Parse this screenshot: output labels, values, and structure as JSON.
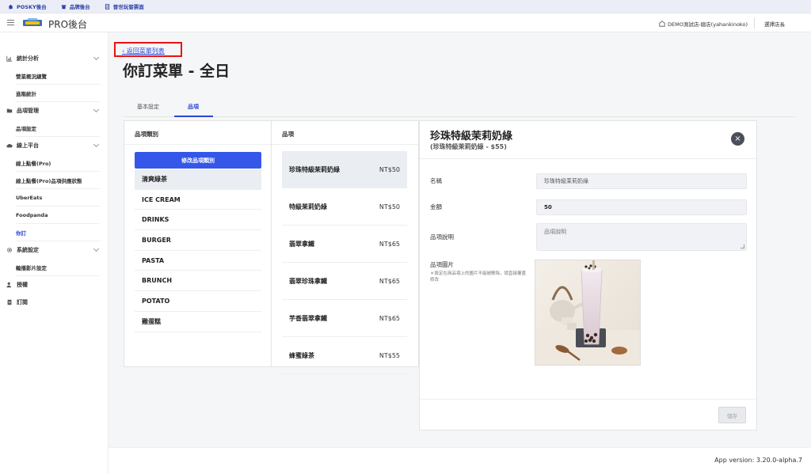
{
  "topbar": {
    "links": [
      {
        "label": "POSKY後台",
        "icon": "home-icon"
      },
      {
        "label": "品牌後台",
        "icon": "store-icon"
      },
      {
        "label": "晉世玩發票面",
        "icon": "receipt-icon"
      }
    ]
  },
  "header": {
    "brand": "PRO後台",
    "store": "DEMO測試店-總店(yahankinoko)",
    "switch_label": "選擇店長"
  },
  "sidebar": {
    "groups": [
      {
        "label": "統計分析",
        "icon": "chart-icon",
        "items": [
          "營業概況總覽",
          "進階統計"
        ]
      },
      {
        "label": "品項管理",
        "icon": "folder-icon",
        "items": [
          "品項設定"
        ]
      },
      {
        "label": "線上平台",
        "icon": "cloud-icon",
        "items": [
          "線上點餐(Pro)",
          "線上點餐(Pro)品項供應狀態",
          "UberEats",
          "Foodpanda",
          "你訂"
        ]
      },
      {
        "label": "系統設定",
        "icon": "gear-icon",
        "items": [
          "輪播影片設定"
        ]
      },
      {
        "label": "授權",
        "icon": "user-key-icon",
        "items": []
      },
      {
        "label": "訂閱",
        "icon": "document-icon",
        "items": []
      }
    ],
    "active_item": "你訂"
  },
  "content": {
    "back_link": "返回菜單列表",
    "page_title": "你訂菜單 - 全日",
    "tabs": [
      "基本設定",
      "品項"
    ],
    "active_tab": "品項"
  },
  "categories": {
    "title": "品項類別",
    "edit_button": "修改品項類別",
    "list": [
      "清爽綠茶",
      "ICE CREAM",
      "DRINKS",
      "BURGER",
      "PASTA",
      "BRUNCH",
      "POTATO",
      "雞蛋糕"
    ],
    "selected": "清爽綠茶"
  },
  "items": {
    "title": "品項",
    "list": [
      {
        "name": "珍珠特級茉莉奶綠",
        "price": "NT$50"
      },
      {
        "name": "特級茉莉奶綠",
        "price": "NT$50"
      },
      {
        "name": "翡翠拿鐵",
        "price": "NT$65"
      },
      {
        "name": "翡翠珍珠拿鐵",
        "price": "NT$65"
      },
      {
        "name": "芋香翡翠拿鐵",
        "price": "NT$65"
      },
      {
        "name": "蜂蜜綠茶",
        "price": "NT$55"
      }
    ],
    "selected": "珍珠特級茉莉奶綠"
  },
  "detail": {
    "name": "珍珠特級茉莉奶綠",
    "subtitle": "(珍珠特級茉莉奶綠 - $55)",
    "fields": {
      "name_label": "名稱",
      "name_value": "珍珠特級茉莉奶綠",
      "price_label": "金額",
      "price_value": "50",
      "desc_label": "品項說明",
      "desc_placeholder": "品項說明",
      "image_label": "品項圖片",
      "image_note": "＊設定在商品項上的圖片不能被刪除，請直接覆蓋修改"
    },
    "save_button": "儲存"
  },
  "footer": {
    "version": "App version: 3.20.0-alpha.7"
  },
  "colors": {
    "accent": "#3557e9",
    "highlight_box": "#ee1111"
  }
}
